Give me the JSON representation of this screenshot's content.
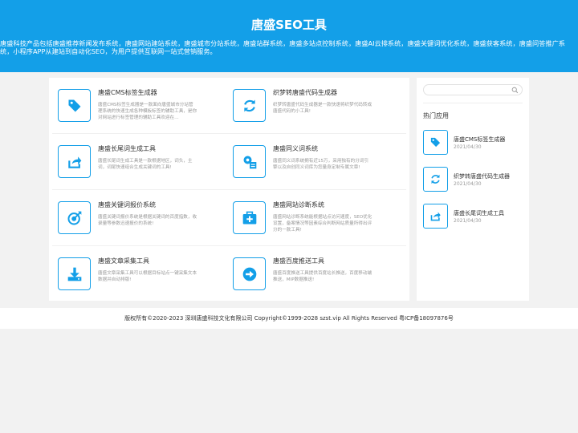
{
  "header": {
    "title": "唐盛SEO工具",
    "description": "唐盛科技产品包括唐盛推荐新闻发布系统，唐盛网站建站系统，唐盛城市分站系统，唐盛站群系统，唐盛多站点控制系统，唐盛AI云排系统，唐盛关键词优化系统，唐盛获客系统，唐盛问答推广系统，小程序APP从建站到自动化SEO，为用户提供互联网一站式营销服务。"
  },
  "tools": [
    {
      "title": "唐盛CMS标签生成器",
      "desc": "唐盛CMS标签生成器是一款面向唐盛城市分站管理系统的快速生成各种模板标签的辅助工具，是你对网站进行标签管理的辅助工具欢迎在…",
      "icon": "tag-icon"
    },
    {
      "title": "织梦转唐盛代码生成器",
      "desc": "织梦转唐盛代码生成器是一款快速将织梦代码转成唐盛代码的小工具!",
      "icon": "refresh-icon"
    },
    {
      "title": "唐盛长尾词生成工具",
      "desc": "唐盛长尾词生成工具是一款根据地区，词头，主词，词尾快速组合生成关键词的工具!",
      "icon": "share-icon"
    },
    {
      "title": "唐盛同义词系统",
      "desc": "唐盛同义词系统拥有近15万，采用独有的分词引擎以及自创同义词库为您量身定制专属文章!",
      "icon": "gear-doc-icon"
    },
    {
      "title": "唐盛关键词报价系统",
      "desc": "唐盛关键词报价系统是根据关键词的百度指数，收录量等参数迅速报价的系统!",
      "icon": "target-icon"
    },
    {
      "title": "唐盛网站诊断系统",
      "desc": "唐盛网站诊断系统能根据站点访问速度，SEO优化设置，备案情况等因素综合判断网站质量所得出评分的一款工具!",
      "icon": "medical-kit-icon"
    },
    {
      "title": "唐盛文章采集工具",
      "desc": "唐盛文章采集工具可以根据目标站点一键采集文本数据并自动排版!",
      "icon": "download-icon"
    },
    {
      "title": "唐盛百度推送工具",
      "desc": "唐盛百度推送工具提供百度站长推送，百度移动端推送，MIP数据推送!",
      "icon": "arrow-circle-icon"
    }
  ],
  "sidebar": {
    "search_placeholder": "",
    "heading": "热门应用",
    "items": [
      {
        "title": "唐盛CMS标签生成器",
        "date": "2021/04/30",
        "icon": "tag-icon"
      },
      {
        "title": "织梦转唐盛代码生成器",
        "date": "2021/04/30",
        "icon": "refresh-icon"
      },
      {
        "title": "唐盛长尾词生成工具",
        "date": "2021/04/30",
        "icon": "share-icon"
      }
    ]
  },
  "footer": {
    "copyright": "版权所有©2020-2023 深圳唐盛科技文化有限公司 Copyright©1999-2028 szst.vip All Rights Reserved 粤ICP备18097876号"
  },
  "colors": {
    "accent": "#139fe8"
  }
}
